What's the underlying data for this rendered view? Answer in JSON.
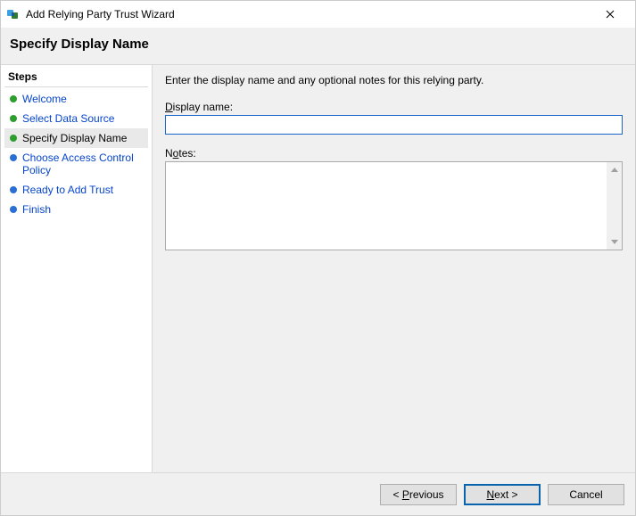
{
  "window": {
    "title": "Add Relying Party Trust Wizard"
  },
  "header": {
    "page_title": "Specify Display Name"
  },
  "steps": {
    "heading": "Steps",
    "items": [
      {
        "label": "Welcome",
        "state": "done"
      },
      {
        "label": "Select Data Source",
        "state": "done"
      },
      {
        "label": "Specify Display Name",
        "state": "current"
      },
      {
        "label": "Choose Access Control Policy",
        "state": "pending"
      },
      {
        "label": "Ready to Add Trust",
        "state": "pending"
      },
      {
        "label": "Finish",
        "state": "pending"
      }
    ]
  },
  "content": {
    "instruction": "Enter the display name and any optional notes for this relying party.",
    "display_name_label": "Display name:",
    "display_name_value": "",
    "notes_label": "Notes:",
    "notes_value": ""
  },
  "footer": {
    "previous": "< Previous",
    "next": "Next >",
    "cancel": "Cancel"
  }
}
